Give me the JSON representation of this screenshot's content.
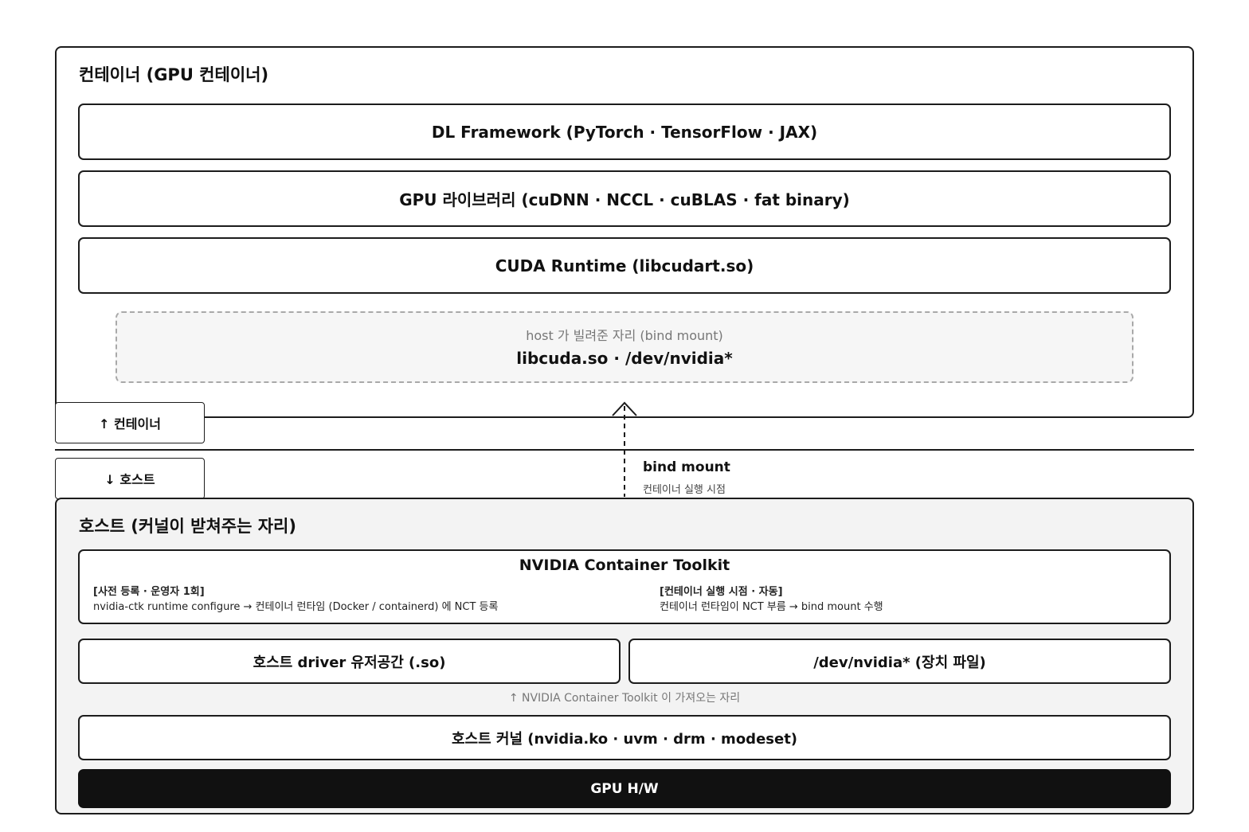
{
  "container": {
    "title": "컨테이너 (GPU 컨테이너)",
    "layers": {
      "dl_framework": "DL Framework (PyTorch · TensorFlow · JAX)",
      "gpu_libraries": "GPU 라이브러리 (cuDNN · NCCL · cuBLAS · fat binary)",
      "cuda_runtime": "CUDA Runtime (libcudart.so)"
    },
    "bind_slot": {
      "caption": "host 가 빌려준 자리 (bind mount)",
      "content": "libcuda.so · /dev/nvidia*"
    }
  },
  "boundary": {
    "container_tab": "↑ 컨테이너",
    "host_tab": "↓ 호스트",
    "arrow_label": "bind mount",
    "arrow_sublabel": "컨테이너 실행 시점"
  },
  "host": {
    "title": "호스트 (커널이 받쳐주는 자리)",
    "toolkit": {
      "title": "NVIDIA Container Toolkit",
      "left_heading": "[사전 등록 · 운영자 1회]",
      "left_text": "nvidia-ctk runtime configure → 컨테이너 런타임 (Docker / containerd) 에 NCT 등록",
      "right_heading": "[컨테이너 실행 시점 · 자동]",
      "right_text": "컨테이너 런타임이 NCT 부름 → bind mount 수행"
    },
    "driver_userspace": "호스트 driver 유저공간 (.so)",
    "device_files": "/dev/nvidia* (장치 파일)",
    "toolkit_note": "↑ NVIDIA Container Toolkit 이 가져오는 자리",
    "kernel": "호스트 커널 (nvidia.ko · uvm · drm · modeset)",
    "gpu_hw": "GPU H/W"
  },
  "colors": {
    "border": "#1c1c1c",
    "host_bg": "#f3f3f3",
    "bind_slot_bg": "#f6f6f6",
    "gpu_bg": "#111111",
    "muted_text": "#777777"
  }
}
